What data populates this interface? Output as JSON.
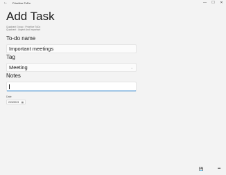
{
  "window": {
    "app_title": "Prioritize ToDo",
    "back_icon": "←",
    "minimize_icon": "—",
    "maximize_icon": "☐",
    "close_icon": "✕"
  },
  "page": {
    "title": "Add Task",
    "quadrant_group": "Quadrant Group : Prioritize ToDo",
    "quadrant": "Quadrant : Urgent And Important"
  },
  "form": {
    "todo_name_label": "To-do name",
    "todo_name_value": "Important meetings",
    "tag_label": "Tag",
    "tag_value": "Meeting",
    "tag_chevron": "⌄",
    "notes_label": "Notes",
    "notes_value": "",
    "date_label": "Date",
    "date_value": "2/20/2023",
    "calendar_icon": "▦"
  },
  "commands": {
    "save_icon": "💾",
    "more_icon": "•••"
  }
}
